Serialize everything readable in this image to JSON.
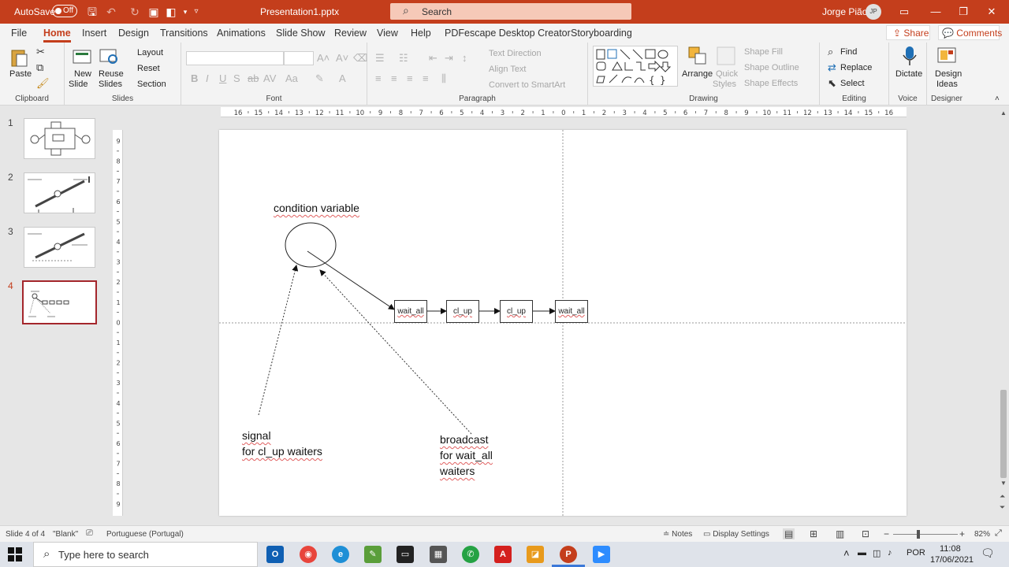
{
  "titlebar": {
    "autosave_label": "AutoSave",
    "autosave_state": "Off",
    "filename": "Presentation1.pptx",
    "search_placeholder": "Search",
    "user_name": "Jorge Pião",
    "user_initials": "JP"
  },
  "tabs": [
    "File",
    "Home",
    "Insert",
    "Design",
    "Transitions",
    "Animations",
    "Slide Show",
    "Review",
    "View",
    "Help",
    "PDFescape Desktop Creator",
    "Storyboarding"
  ],
  "actions": {
    "share": "Share",
    "comments": "Comments"
  },
  "ribbon": {
    "clipboard": {
      "label": "Clipboard",
      "paste": "Paste"
    },
    "slides": {
      "label": "Slides",
      "new_slide": [
        "New",
        "Slide"
      ],
      "reuse_slides": [
        "Reuse",
        "Slides"
      ],
      "layout": "Layout",
      "reset": "Reset",
      "section": "Section"
    },
    "font": {
      "label": "Font"
    },
    "paragraph": {
      "label": "Paragraph",
      "text_direction": "Text Direction",
      "align_text": "Align Text",
      "convert_smartart": "Convert to SmartArt"
    },
    "drawing": {
      "label": "Drawing",
      "arrange": "Arrange",
      "quick_styles": [
        "Quick",
        "Styles"
      ],
      "shape_fill": "Shape Fill",
      "shape_outline": "Shape Outline",
      "shape_effects": "Shape Effects"
    },
    "editing": {
      "label": "Editing",
      "find": "Find",
      "replace": "Replace",
      "select": "Select"
    },
    "voice": {
      "label": "Voice",
      "dictate": "Dictate"
    },
    "designer": {
      "label": "Designer",
      "design_ideas": [
        "Design",
        "Ideas"
      ]
    }
  },
  "thumbnails": [
    "1",
    "2",
    "3",
    "4"
  ],
  "ruler": {
    "horizontal": [
      "16",
      "15",
      "14",
      "13",
      "12",
      "11",
      "10",
      "9",
      "8",
      "7",
      "6",
      "5",
      "4",
      "3",
      "2",
      "1",
      "0",
      "1",
      "2",
      "3",
      "4",
      "5",
      "6",
      "7",
      "8",
      "9",
      "10",
      "11",
      "12",
      "13",
      "14",
      "15",
      "16"
    ],
    "vertical": [
      "9",
      "8",
      "7",
      "6",
      "5",
      "4",
      "3",
      "2",
      "1",
      "0",
      "1",
      "2",
      "3",
      "4",
      "5",
      "6",
      "7",
      "8",
      "9"
    ]
  },
  "slide": {
    "circle_label": "condition variable",
    "queue": [
      "wait_all",
      "cl_up",
      "cl_up",
      "wait_all"
    ],
    "signal_lines": [
      "signal",
      "for cl_up waiters"
    ],
    "broadcast_lines": [
      "broadcast",
      "for wait_all",
      "waiters"
    ]
  },
  "status": {
    "slide_info": "Slide 4 of 4",
    "layout_name": "\"Blank\"",
    "language": "Portuguese (Portugal)",
    "notes": "Notes",
    "display_settings": "Display Settings",
    "zoom": "82%"
  },
  "taskbar": {
    "search_placeholder": "Type here to search",
    "language": "POR",
    "time": "11:08",
    "date": "17/06/2021"
  },
  "colors": {
    "accent": "#c43e1c",
    "active_thumb": "#a4262c"
  }
}
